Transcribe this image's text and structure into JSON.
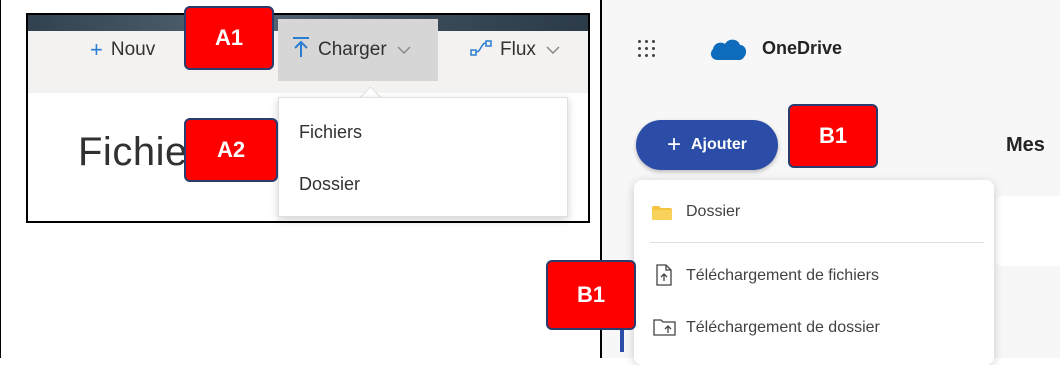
{
  "left_panel": {
    "toolbar": {
      "new_label": "Nouv",
      "upload_label": "Charger",
      "flow_label": "Flux"
    },
    "page_heading": "Fichie",
    "upload_menu": {
      "items": [
        "Fichiers",
        "Dossier"
      ]
    }
  },
  "right_panel": {
    "app_title": "OneDrive",
    "add_button_label": "Ajouter",
    "heading_partial": "Mes",
    "add_menu": {
      "items": [
        "Dossier",
        "Téléchargement de fichiers",
        "Téléchargement de dossier"
      ]
    }
  },
  "callouts": {
    "a1": "A1",
    "a2": "A2",
    "b1_top": "B1",
    "b1_bottom": "B1"
  },
  "colors": {
    "callout_fill": "#ff0000",
    "accent_blue": "#2b4da8",
    "onedrive_blue": "#0f6cbd"
  },
  "icons": {
    "new": "plus-icon",
    "upload": "upload-arrow-icon",
    "flow": "flow-icon",
    "waffle": "app-launcher-icon",
    "cloud": "onedrive-cloud-icon",
    "folder": "folder-icon",
    "file_upload": "file-upload-icon",
    "folder_upload": "folder-upload-icon"
  }
}
